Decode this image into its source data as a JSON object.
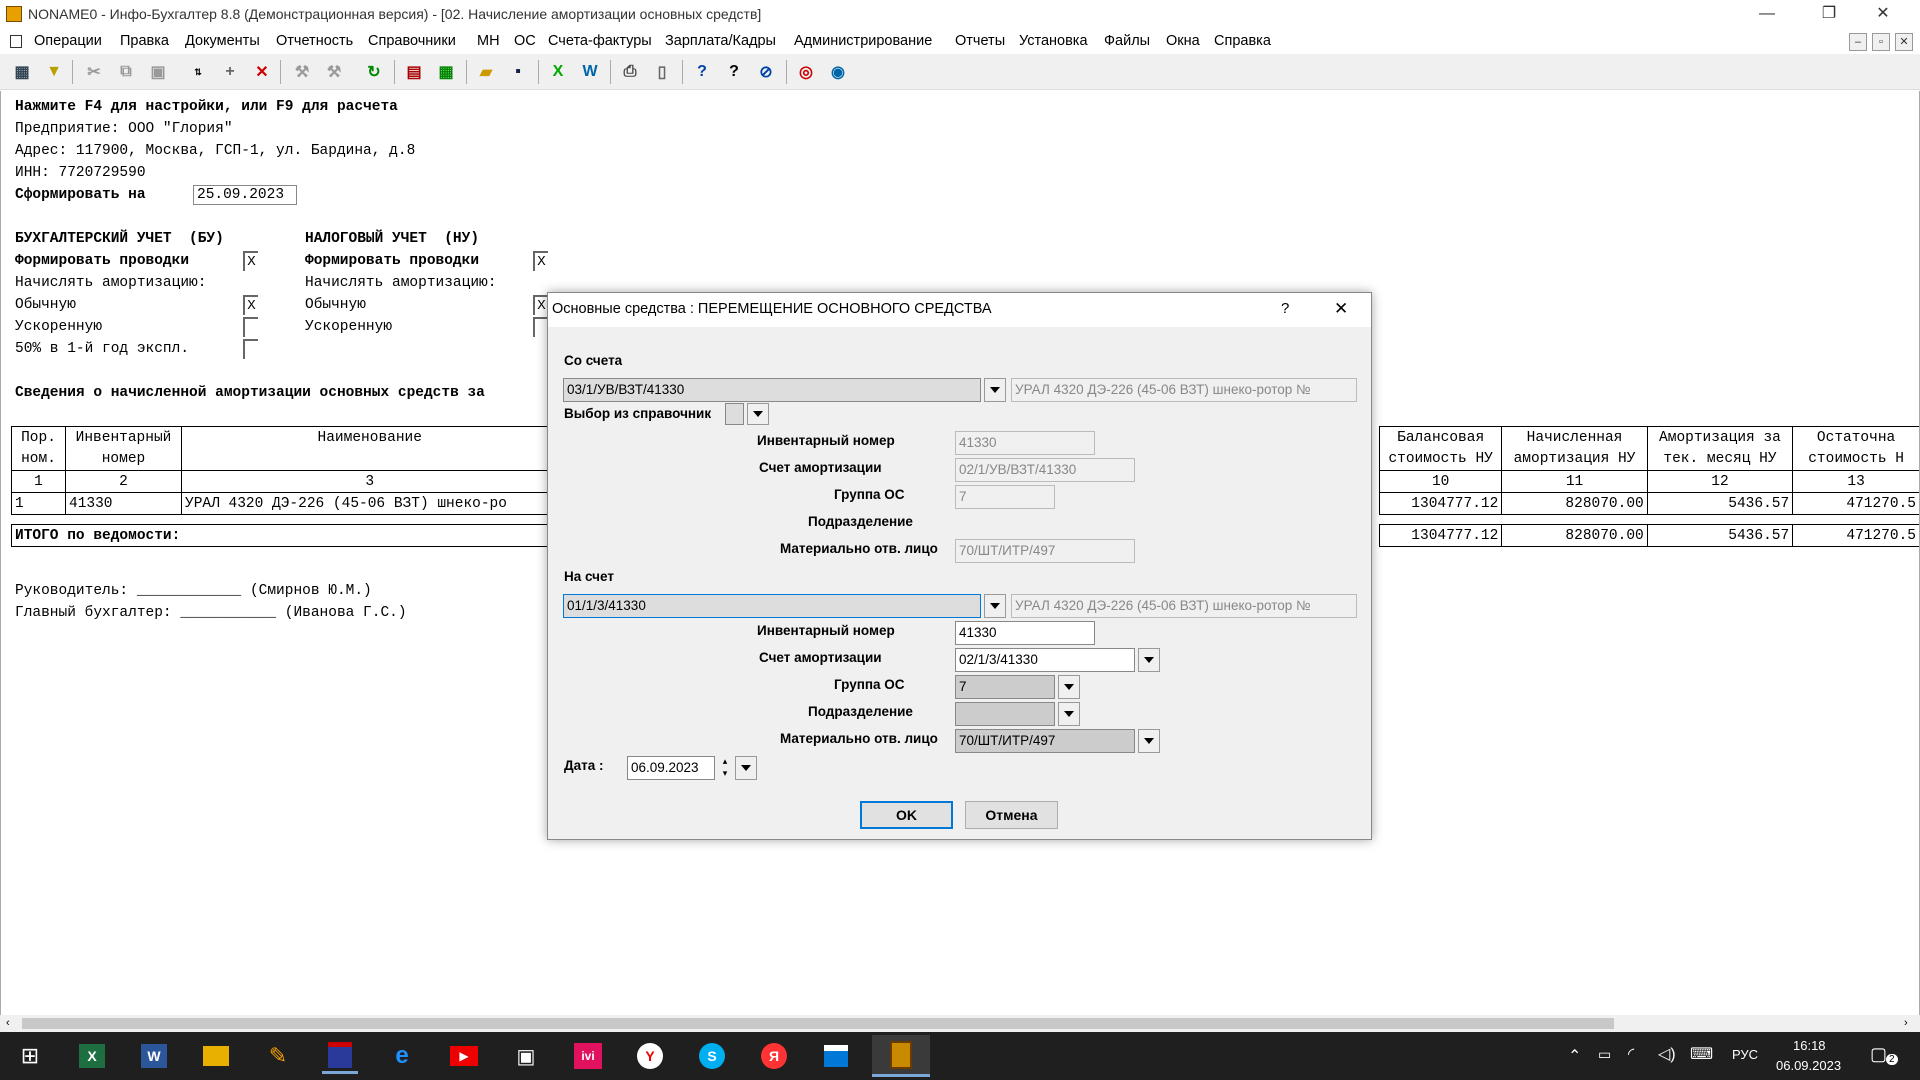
{
  "window": {
    "title": "NONAME0 - Инфо-Бухгалтер 8.8 (Демонстрационная версия) - [02.   Начисление амортизации основных средств]",
    "controls": {
      "minimize": "—",
      "restore": "❐",
      "close": "✕"
    }
  },
  "menu": [
    "Операции",
    "Правка",
    "Документы",
    "Отчетность",
    "Справочники",
    "МН",
    "ОС",
    "Счета-фактуры",
    "Зарплата/Кадры",
    "Администрирование",
    "Отчеты",
    "Установка",
    "Файлы",
    "Окна",
    "Справка"
  ],
  "report": {
    "hint": "Нажмите F4 для настройки, или F9 для расчета",
    "enterprise": "Предприятие: ООО \"Глория\"",
    "address": "Адрес: 117900, Москва, ГСП-1, ул. Бардина, д.8",
    "inn": "ИНН: 7720729590",
    "form_on_label": "Сформировать на",
    "form_on_date": "25.09.2023",
    "bu_title": "БУХГАЛТЕРСКИЙ УЧЕТ  (БУ)",
    "nu_title": "НАЛОГОВЫЙ УЧЕТ  (НУ)",
    "bu_form_postings": "Формировать проводки",
    "bu_accrue": "Начислять амортизацию:",
    "bu_normal": "Обычную",
    "bu_accelerated": "Ускоренную",
    "bu_50": "50% в 1-й год экспл.",
    "nu_form_postings": "Формировать проводки",
    "nu_accrue": "Начислять амортизацию:",
    "nu_normal": "Обычную",
    "nu_accelerated": "Ускоренную",
    "check_x": "X",
    "info_title": "Сведения о начисленной амортизации основных средств за",
    "table_left": {
      "h1": [
        "Пор.",
        "Инвентарный",
        "Наименование"
      ],
      "h2": [
        "ном.",
        "номер",
        ""
      ],
      "nums": [
        "1",
        "2",
        "3"
      ],
      "row": [
        "1",
        "41330",
        "УРАЛ 4320 ДЭ-226 (45-06 ВЗТ) шнеко-ро"
      ],
      "total": "ИТОГО по ведомости:"
    },
    "table_right": {
      "h1": [
        "Балансовая",
        "Начисленная",
        "Амортизация за",
        "Остаточна"
      ],
      "h2": [
        "стоимость НУ",
        "амортизация НУ",
        "тек. месяц НУ",
        "стоимость Н"
      ],
      "nums": [
        "10",
        "11",
        "12",
        "13"
      ],
      "row": [
        "1304777.12",
        "828070.00",
        "5436.57",
        "471270.5"
      ],
      "total": [
        "1304777.12",
        "828070.00",
        "5436.57",
        "471270.5"
      ]
    },
    "head_label": "Руководитель: ____________ (Смирнов Ю.М.)",
    "chief_label": "Главный бухгалтер: ___________ (Иванова Г.С.)"
  },
  "dialog": {
    "title": "Основные средства : ПЕРЕМЕЩЕНИЕ ОСНОВНОГО СРЕДСТВА",
    "help": "?",
    "close": "✕",
    "from_label": "Со счета",
    "from_account": "03/1/УВ/ВЗТ/41330",
    "from_desc": "УРАЛ 4320 ДЭ-226 (45-06 ВЗТ) шнеко-ротор №",
    "choose_label": "Выбор из справочник",
    "inv_label": "Инвентарный номер",
    "amort_label": "Счет амортизации",
    "group_label": "Группа ОС",
    "dept_label": "Подразделение",
    "mol_label": "Материально отв. лицо",
    "from_inv": "41330",
    "from_amort": "02/1/УВ/ВЗТ/41330",
    "from_group": "7",
    "from_dept": "",
    "from_mol": "70/ШТ/ИТР/497",
    "to_label": "На счет",
    "to_account": "01/1/3/41330",
    "to_desc": "УРАЛ 4320 ДЭ-226 (45-06 ВЗТ) шнеко-ротор №",
    "to_inv": "41330",
    "to_amort": "02/1/3/41330",
    "to_group": "7",
    "to_dept": "",
    "to_mol": "70/ШТ/ИТР/497",
    "date_label": "Дата  :",
    "date_value": "06.09.2023",
    "ok": "OK",
    "cancel": "Отмена"
  },
  "taskbar": {
    "lang": "РУС",
    "time": "16:18",
    "date": "06.09.2023",
    "notif_count": "2"
  }
}
